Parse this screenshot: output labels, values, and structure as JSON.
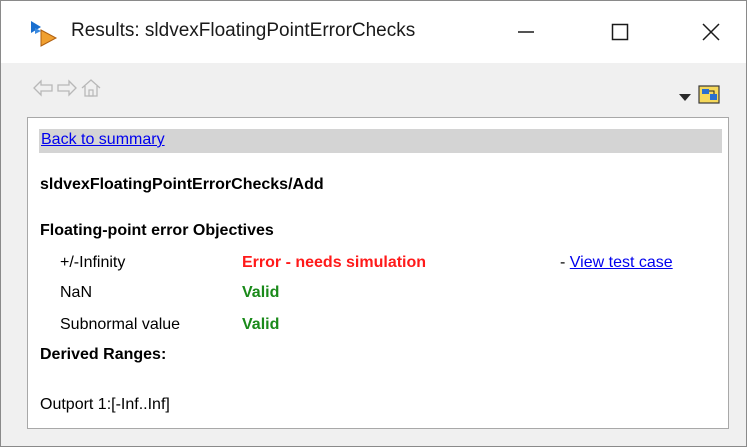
{
  "window": {
    "title": "Results: sldvexFloatingPointErrorChecks",
    "icons": {
      "app": "simulink-results-icon",
      "minimize": "minimize-icon",
      "maximize": "maximize-icon",
      "close": "close-icon"
    }
  },
  "toolbar": {
    "icons": [
      "back-arrow-icon",
      "forward-arrow-icon",
      "home-icon",
      "dropdown-triangle-icon",
      "model-tool-icon"
    ]
  },
  "content": {
    "back_link": "Back to summary",
    "block_path": "sldvexFloatingPointErrorChecks/Add",
    "objectives_heading": "Floating-point error Objectives",
    "objectives": [
      {
        "name": "+/-Infinity",
        "status": "Error - needs simulation",
        "status_color": "#ff1a1a"
      },
      {
        "name": "NaN",
        "status": "Valid",
        "status_color": "#1a8a1a"
      },
      {
        "name": "Subnormal value",
        "status": "Valid",
        "status_color": "#1a8a1a"
      }
    ],
    "test_case_prefix": "- ",
    "test_case_link": "View test case",
    "derived_ranges_heading": "Derived Ranges:",
    "outport_range": "Outport 1:[-Inf..Inf]"
  }
}
